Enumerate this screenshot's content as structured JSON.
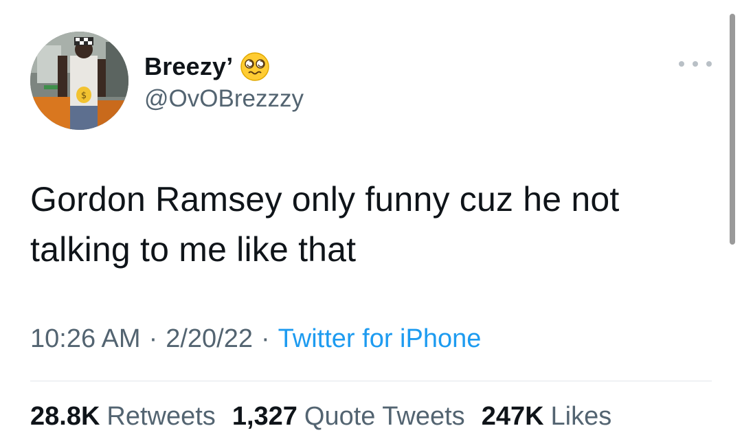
{
  "author": {
    "display_name": "Breezy’",
    "handle": "@OvOBrezzzy",
    "name_emoji": "dizzy-face-emoji"
  },
  "tweet": {
    "text_line1": "Gordon Ramsey only funny cuz he not",
    "text_line2": "talking to me like that"
  },
  "meta": {
    "time": "10:26 AM",
    "separator": "·",
    "date": "2/20/22",
    "source": "Twitter for iPhone"
  },
  "stats": {
    "retweets_count": "28.8K",
    "retweets_label": "Retweets",
    "quotes_count": "1,327",
    "quotes_label": "Quote Tweets",
    "likes_count": "247K",
    "likes_label": "Likes"
  },
  "icons": {
    "more": "more-options-icon"
  },
  "colors": {
    "text_primary": "#0f1419",
    "text_secondary": "#536471",
    "link": "#1d9bf0",
    "divider": "#e1e6ea"
  }
}
